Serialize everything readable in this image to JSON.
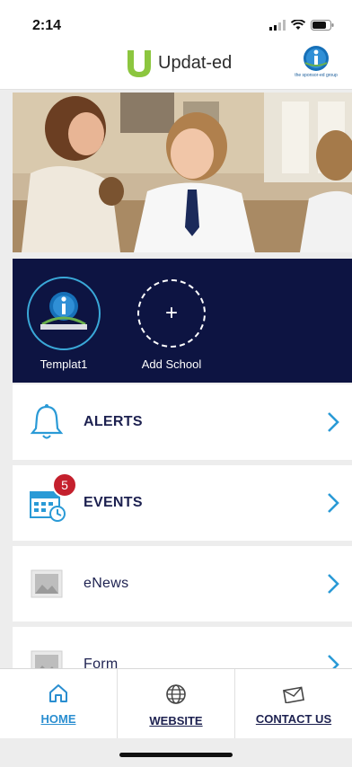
{
  "status": {
    "time": "2:14"
  },
  "header": {
    "brand": "Updat-ed",
    "partner_text": "the sponsor-ed group"
  },
  "schools": [
    {
      "name": "Templat1"
    },
    {
      "name": "Add School",
      "symbol": "+"
    }
  ],
  "menu": {
    "items": [
      {
        "label": "ALERTS",
        "icon": "bell-icon"
      },
      {
        "label": "EVENTS",
        "icon": "calendar-icon",
        "badge": "5"
      },
      {
        "label": "eNews",
        "icon": "image-icon"
      },
      {
        "label": "Form",
        "icon": "image-icon"
      }
    ]
  },
  "tabs": [
    {
      "label": "HOME",
      "icon": "home-icon"
    },
    {
      "label": "WEBSITE",
      "icon": "globe-icon"
    },
    {
      "label": "CONTACT US",
      "icon": "envelope-icon"
    }
  ],
  "colors": {
    "navy": "#0d1442",
    "accent": "#2a8ed0",
    "badge": "#c4202d",
    "brand_green": "#8cc63f"
  }
}
